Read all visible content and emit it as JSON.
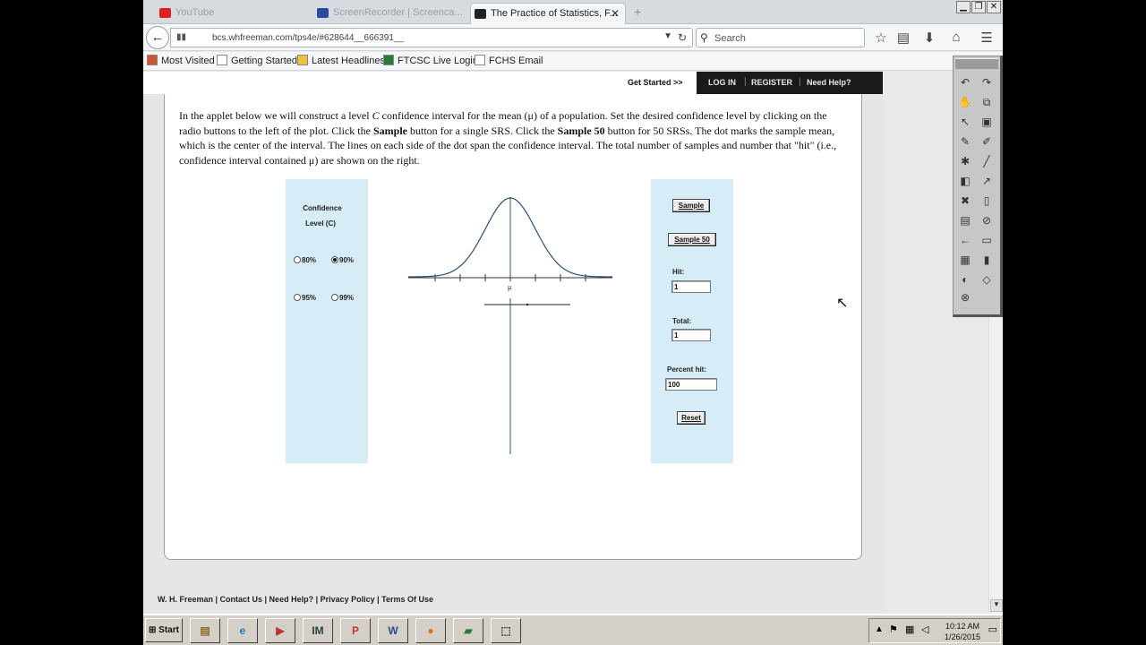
{
  "browser": {
    "tabs": [
      {
        "label": "YouTube",
        "active": false,
        "color": "#e02020"
      },
      {
        "label": "ScreenRecorder | Screenca...",
        "active": false,
        "color": "#2a4aa0"
      },
      {
        "label": "The Practice of Statistics, F...",
        "active": true,
        "color": "#222222"
      }
    ],
    "new_tab": "+",
    "url_site": "▮▮",
    "url": "bcs.whfreeman.com/tps4e/#628644__666391__",
    "search_placeholder": "Search",
    "bookmarks": [
      "Most Visited",
      "Getting Started",
      "Latest Headlines",
      "FTCSC Live Login",
      "FCHS Email"
    ]
  },
  "site": {
    "get_started": "Get Started >>",
    "top_links": [
      "LOG IN",
      "REGISTER",
      "Need Help?"
    ],
    "footer": "W. H. Freeman | Contact Us | Need Help? | Privacy Policy | Terms Of Use"
  },
  "intro": {
    "p1": "In the applet below we will construct a level ",
    "c": "C",
    "p2": " confidence interval for the mean (μ) of a population. Set the desired confidence level by clicking on the radio buttons to the left of the plot. Click the ",
    "sample": "Sample",
    "p3": " button for a single SRS. Click the ",
    "sample50": "Sample 50",
    "p4": " button for 50 SRSs. The dot marks the sample mean, which is the center of the interval. The lines on each side of the dot span the confidence interval. The total number of samples and number that \"hit\" (i.e., confidence interval contained μ) are shown on the right."
  },
  "applet": {
    "confidence_label_1": "Confidence",
    "confidence_label_2": "Level (C)",
    "options": [
      {
        "label": "80%",
        "selected": false
      },
      {
        "label": "90%",
        "selected": true
      },
      {
        "label": "95%",
        "selected": false
      },
      {
        "label": "99%",
        "selected": false
      }
    ],
    "mu_label": "μ",
    "sample_button": "Sample",
    "sample50_button": "Sample 50",
    "hit_label": "Hit:",
    "hit_value": "1",
    "total_label": "Total:",
    "total_value": "1",
    "percent_label": "Percent hit:",
    "percent_value": "100",
    "reset_button": "Reset",
    "colors": {
      "panel_bg": "#d6ecf7",
      "curve": "#2b4f7a",
      "mu_line": "#1f6b2a"
    }
  },
  "taskbar": {
    "start": "Start",
    "time": "10:12 AM",
    "date": "1/26/2015",
    "apps": [
      "file-manager",
      "internet-explorer",
      "media",
      "IM",
      "powerpoint",
      "word",
      "firefox",
      "screen-app",
      "capture"
    ]
  }
}
